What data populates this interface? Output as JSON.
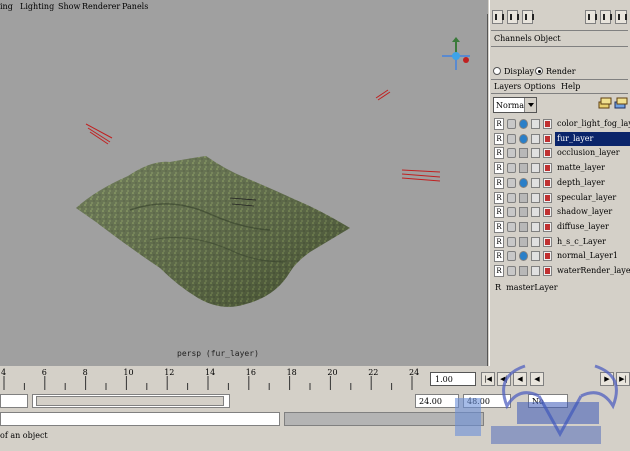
{
  "viewport": {
    "menu": [
      "ing",
      "Lighting",
      "Show",
      "Renderer",
      "Panels"
    ],
    "camera_label": "persp (fur_layer)"
  },
  "channel_box": {
    "menu": [
      "Channels",
      "Object"
    ]
  },
  "layer_editor": {
    "modes": [
      {
        "label": "Display",
        "selected": false
      },
      {
        "label": "Render",
        "selected": true
      }
    ],
    "menu": [
      "Layers",
      "Options",
      "Help"
    ],
    "blend_mode": "Normal",
    "render_label": "R",
    "layers": [
      {
        "name": "color_light_fog_layer",
        "selected": false,
        "render": "R"
      },
      {
        "name": "fur_layer",
        "selected": true,
        "render": "R"
      },
      {
        "name": "occlusion_layer",
        "selected": false,
        "render": "R"
      },
      {
        "name": "matte_layer",
        "selected": false,
        "render": "R"
      },
      {
        "name": "depth_layer",
        "selected": false,
        "render": "R"
      },
      {
        "name": "specular_layer",
        "selected": false,
        "render": "R"
      },
      {
        "name": "shadow_layer",
        "selected": false,
        "render": "R"
      },
      {
        "name": "diffuse_layer",
        "selected": false,
        "render": "R"
      },
      {
        "name": "h_s_c_Layer",
        "selected": false,
        "render": "R"
      },
      {
        "name": "normal_Layer1",
        "selected": false,
        "render": "R"
      },
      {
        "name": "waterRender_laye",
        "selected": false,
        "render": "R"
      }
    ],
    "master_layer": "masterLayer"
  },
  "time_slider": {
    "ticks": [
      "4",
      "6",
      "8",
      "10",
      "12",
      "14",
      "16",
      "18",
      "20",
      "22",
      "24"
    ],
    "current_time": "1.00"
  },
  "range_slider": {
    "end_time": "24.00",
    "playback_end": "48.00",
    "char_set": "No"
  },
  "help_line": {
    "text": "of an object"
  }
}
